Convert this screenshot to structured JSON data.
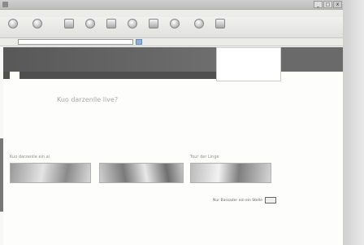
{
  "window": {
    "title": "",
    "buttons": [
      "_",
      "□",
      "x"
    ]
  },
  "menu": [
    "",
    "",
    "",
    "",
    ""
  ],
  "toolbar": [
    {
      "label": "",
      "icon": "back-icon"
    },
    {
      "label": "",
      "icon": "forward-icon"
    },
    {
      "label": "",
      "icon": "stop-icon"
    },
    {
      "label": "",
      "icon": "refresh-icon"
    },
    {
      "label": "",
      "icon": "home-icon"
    },
    {
      "label": "",
      "icon": "search-icon"
    },
    {
      "label": "",
      "icon": "favorites-icon"
    },
    {
      "label": "",
      "icon": "media-icon"
    },
    {
      "label": "",
      "icon": "history-icon"
    },
    {
      "label": "",
      "icon": "mail-icon"
    }
  ],
  "address": {
    "label": "",
    "value": "",
    "links": [
      "",
      "",
      "",
      "",
      "",
      ""
    ]
  },
  "banner": {
    "side_lines": [
      "",
      "",
      "",
      ""
    ]
  },
  "nav": [
    "",
    "",
    "",
    "",
    ""
  ],
  "content": {
    "headline": "Kuo darzenlle live?",
    "sub": "",
    "para1": "",
    "para2": "",
    "sidebar": ""
  },
  "sections": [
    {
      "title": "Kuo darzenlle ein ai",
      "caption": ""
    },
    {
      "title": "",
      "caption": ""
    },
    {
      "title": "Tour der Linge",
      "caption": ""
    }
  ],
  "footer": {
    "link": "Nur Bassader ein ein Stelle",
    "button": ""
  },
  "colors": {
    "banner": "#5a5a5a",
    "nav": "#4f4f4f",
    "page": "#fdfdfb"
  }
}
